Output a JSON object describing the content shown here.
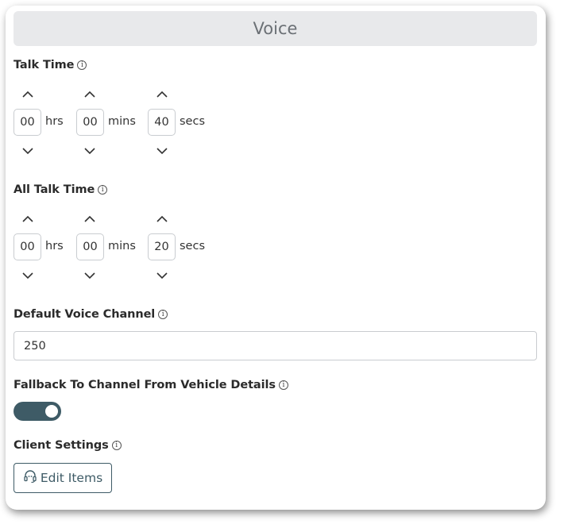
{
  "header": {
    "title": "Voice"
  },
  "talk_time": {
    "label": "Talk Time",
    "hours": {
      "value": "00",
      "unit": "hrs"
    },
    "minutes": {
      "value": "00",
      "unit": "mins"
    },
    "seconds": {
      "value": "40",
      "unit": "secs"
    }
  },
  "all_talk_time": {
    "label": "All Talk Time",
    "hours": {
      "value": "00",
      "unit": "hrs"
    },
    "minutes": {
      "value": "00",
      "unit": "mins"
    },
    "seconds": {
      "value": "20",
      "unit": "secs"
    }
  },
  "default_voice_channel": {
    "label": "Default Voice Channel",
    "value": "250"
  },
  "fallback": {
    "label": "Fallback To Channel From Vehicle Details",
    "enabled": true
  },
  "client_settings": {
    "label": "Client Settings",
    "button_label": "Edit Items"
  },
  "icons": {
    "info": "info-icon",
    "up": "chevron-up-icon",
    "down": "chevron-down-icon",
    "headset": "headset-icon"
  },
  "colors": {
    "accent": "#3e5b66",
    "header_bg": "#e8e9eb"
  }
}
